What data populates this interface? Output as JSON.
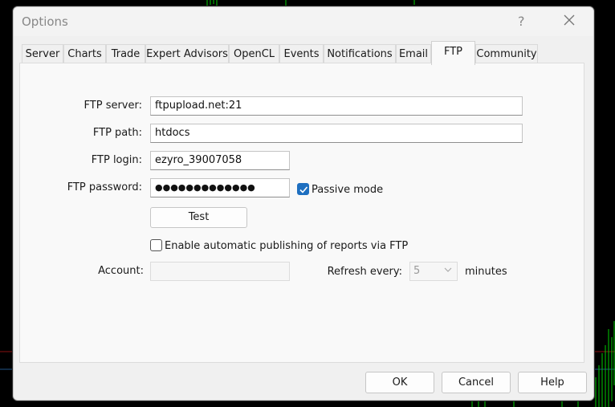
{
  "window": {
    "title": "Options",
    "help_glyph": "?"
  },
  "tabs": [
    {
      "label": "Server"
    },
    {
      "label": "Charts"
    },
    {
      "label": "Trade"
    },
    {
      "label": "Expert Advisors"
    },
    {
      "label": "OpenCL"
    },
    {
      "label": "Events"
    },
    {
      "label": "Notifications"
    },
    {
      "label": "Email"
    },
    {
      "label": "FTP"
    },
    {
      "label": "Community"
    }
  ],
  "active_tab": "FTP",
  "ftp": {
    "server_label": "FTP server:",
    "server_value": "ftpupload.net:21",
    "path_label": "FTP path:",
    "path_value": "htdocs",
    "login_label": "FTP login:",
    "login_value": "ezyro_39007058",
    "password_label": "FTP password:",
    "password_value": "●●●●●●●●●●●●●",
    "passive_label": "Passive mode",
    "passive_checked": true,
    "test_label": "Test",
    "auto_publish_label": "Enable automatic publishing of reports via FTP",
    "auto_publish_checked": false,
    "account_label": "Account:",
    "account_value": "",
    "refresh_label": "Refresh every:",
    "refresh_value": "5",
    "minutes_label": "minutes"
  },
  "footer": {
    "ok_label": "OK",
    "cancel_label": "Cancel",
    "help_label": "Help"
  },
  "colors": {
    "accent": "#1e6fc0",
    "chart_line_green": "#00cc00",
    "chart_line_red": "#cc0000"
  }
}
